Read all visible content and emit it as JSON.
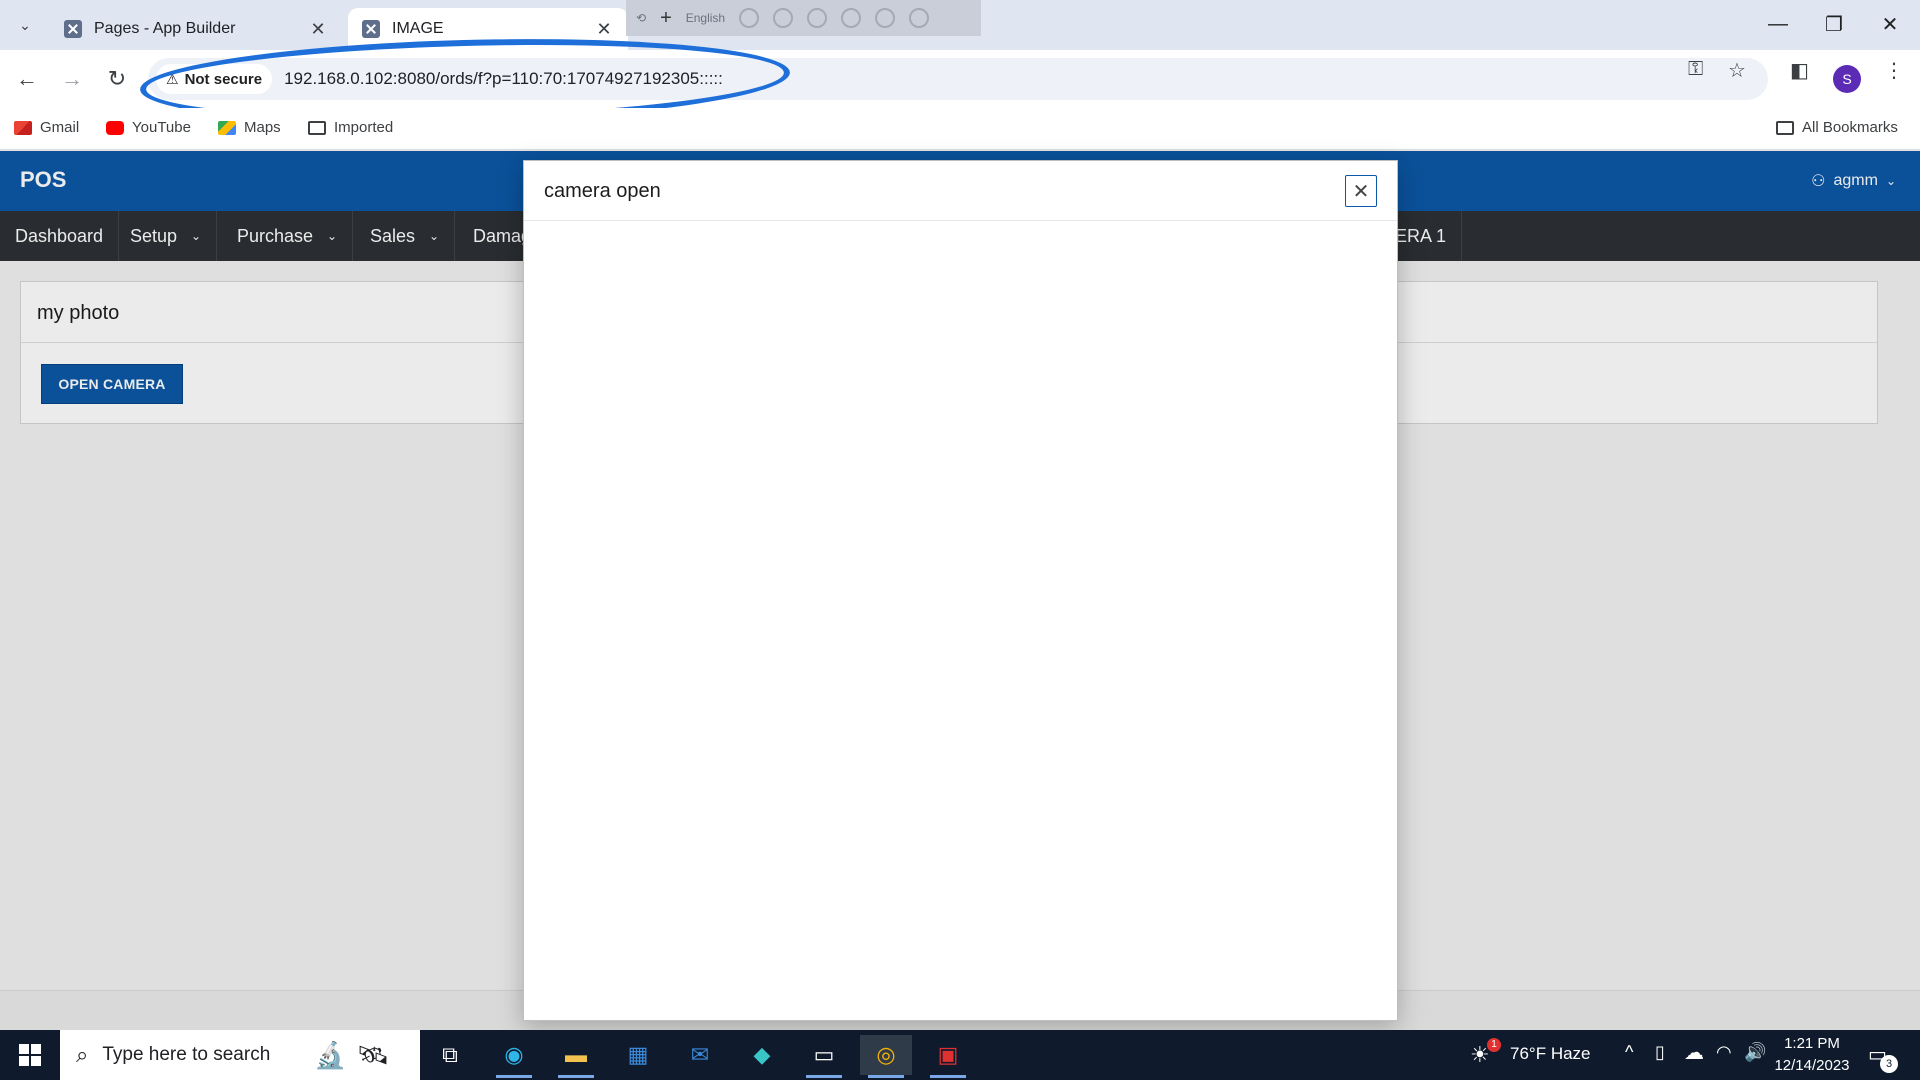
{
  "browser": {
    "tabs": [
      {
        "title": "Pages - App Builder",
        "active": false
      },
      {
        "title": "IMAGE",
        "active": true
      }
    ],
    "ime_language": "English",
    "security_label": "Not secure",
    "url": "192.168.0.102:8080/ords/f?p=110:70:17074927192305:::::",
    "profile_initial": "S",
    "bookmarks": [
      "Gmail",
      "YouTube",
      "Maps",
      "Imported"
    ],
    "all_bookmarks": "All Bookmarks",
    "annotation_color": "#1e6fd9"
  },
  "app": {
    "logo": "POS",
    "user": "agmm",
    "menu": [
      {
        "label": "Dashboard",
        "has_dropdown": false
      },
      {
        "label": "Setup",
        "has_dropdown": true
      },
      {
        "label": "Purchase",
        "has_dropdown": true
      },
      {
        "label": "Sales",
        "has_dropdown": true
      },
      {
        "label": "Damag",
        "has_dropdown": false
      },
      {
        "label": "ERA 1",
        "has_dropdown": false
      }
    ],
    "region_title": "my photo",
    "open_camera_label": "OPEN CAMERA",
    "header_color": "#0b58a8",
    "menubar_color": "#2d3035"
  },
  "dialog": {
    "title": "camera open",
    "close_icon": "close-icon"
  },
  "taskbar": {
    "search_placeholder": "Type here to search",
    "weather": "76°F  Haze",
    "weather_badge": "1",
    "time": "1:21 PM",
    "date": "12/14/2023",
    "notification_count": "3"
  }
}
